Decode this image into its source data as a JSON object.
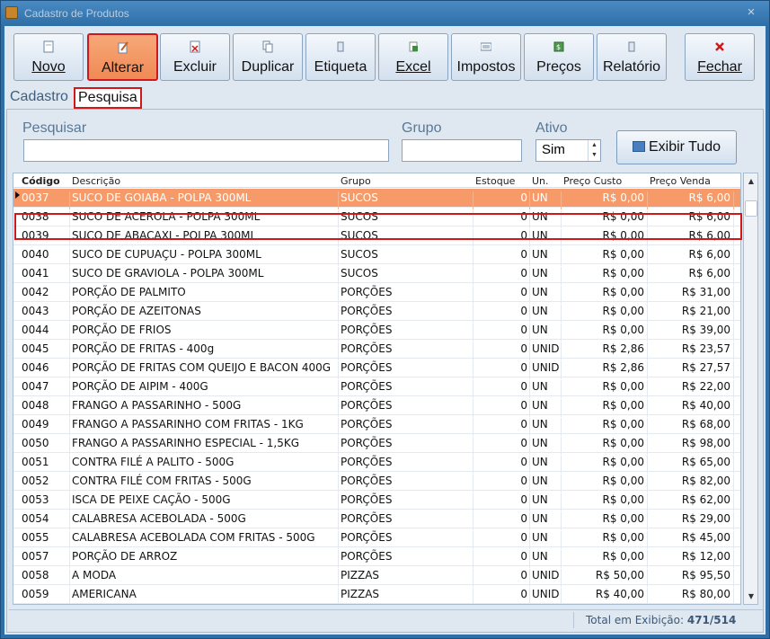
{
  "window": {
    "title": "Cadastro de Produtos",
    "close_label": "×"
  },
  "toolbar": {
    "buttons": [
      {
        "label": "Novo",
        "icon": "new-document-icon"
      },
      {
        "label": "Alterar",
        "icon": "edit-pencil-icon",
        "active": true
      },
      {
        "label": "Excluir",
        "icon": "delete-document-icon"
      },
      {
        "label": "Duplicar",
        "icon": "duplicate-icon"
      },
      {
        "label": "Etiqueta",
        "icon": "label-icon"
      },
      {
        "label": "Excel",
        "icon": "excel-icon"
      },
      {
        "label": "Impostos",
        "icon": "taxes-icon"
      },
      {
        "label": "Preços",
        "icon": "prices-icon"
      },
      {
        "label": "Relatório",
        "icon": "report-icon"
      },
      {
        "label": "Fechar",
        "icon": "close-x-icon"
      }
    ]
  },
  "tabs": [
    {
      "label": "Cadastro",
      "active": false
    },
    {
      "label": "Pesquisa",
      "active": true
    }
  ],
  "filters": {
    "pesquisar_label": "Pesquisar",
    "pesquisar_value": "",
    "grupo_label": "Grupo",
    "grupo_value": "",
    "ativo_label": "Ativo",
    "ativo_value": "Sim",
    "exibir_tudo_label": "Exibir Tudo"
  },
  "grid": {
    "columns": [
      "Código",
      "Descrição",
      "Grupo",
      "Estoque",
      "Un.",
      "Preço Custo",
      "Preço Venda"
    ],
    "rows": [
      [
        "0037",
        "SUCO DE GOIABA - POLPA 300ML",
        "SUCOS",
        "0",
        "UN",
        "R$ 0,00",
        "R$ 6,00"
      ],
      [
        "0038",
        "SUCO DE ACEROLA - POLPA 300ML",
        "SUCOS",
        "0",
        "UN",
        "R$ 0,00",
        "R$ 6,00"
      ],
      [
        "0039",
        "SUCO DE ABACAXI - POLPA 300ML",
        "SUCOS",
        "0",
        "UN",
        "R$ 0,00",
        "R$ 6,00"
      ],
      [
        "0040",
        "SUCO DE CUPUAÇU - POLPA 300ML",
        "SUCOS",
        "0",
        "UN",
        "R$ 0,00",
        "R$ 6,00"
      ],
      [
        "0041",
        "SUCO DE GRAVIOLA - POLPA 300ML",
        "SUCOS",
        "0",
        "UN",
        "R$ 0,00",
        "R$ 6,00"
      ],
      [
        "0042",
        "PORÇÃO DE PALMITO",
        "PORÇÕES",
        "0",
        "UN",
        "R$ 0,00",
        "R$ 31,00"
      ],
      [
        "0043",
        "PORÇÃO DE AZEITONAS",
        "PORÇÕES",
        "0",
        "UN",
        "R$ 0,00",
        "R$ 21,00"
      ],
      [
        "0044",
        "PORÇÃO DE FRIOS",
        "PORÇÕES",
        "0",
        "UN",
        "R$ 0,00",
        "R$ 39,00"
      ],
      [
        "0045",
        "PORÇÃO DE FRITAS - 400g",
        "PORÇÕES",
        "0",
        "UNID",
        "R$ 2,86",
        "R$ 23,57"
      ],
      [
        "0046",
        "PORÇÃO DE FRITAS COM QUEIJO E BACON 400G",
        "PORÇÕES",
        "0",
        "UNID",
        "R$ 2,86",
        "R$ 27,57"
      ],
      [
        "0047",
        "PORÇÃO DE AIPIM - 400G",
        "PORÇÕES",
        "0",
        "UN",
        "R$ 0,00",
        "R$ 22,00"
      ],
      [
        "0048",
        "FRANGO A PASSARINHO - 500G",
        "PORÇÕES",
        "0",
        "UN",
        "R$ 0,00",
        "R$ 40,00"
      ],
      [
        "0049",
        "FRANGO A PASSARINHO COM FRITAS - 1KG",
        "PORÇÕES",
        "0",
        "UN",
        "R$ 0,00",
        "R$ 68,00"
      ],
      [
        "0050",
        "FRANGO A PASSARINHO ESPECIAL - 1,5KG",
        "PORÇÕES",
        "0",
        "UN",
        "R$ 0,00",
        "R$ 98,00"
      ],
      [
        "0051",
        "CONTRA FILÉ A PALITO - 500G",
        "PORÇÕES",
        "0",
        "UN",
        "R$ 0,00",
        "R$ 65,00"
      ],
      [
        "0052",
        "CONTRA FILÉ COM FRITAS - 500G",
        "PORÇÕES",
        "0",
        "UN",
        "R$ 0,00",
        "R$ 82,00"
      ],
      [
        "0053",
        "ISCA DE PEIXE CAÇÃO - 500G",
        "PORÇÕES",
        "0",
        "UN",
        "R$ 0,00",
        "R$ 62,00"
      ],
      [
        "0054",
        "CALABRESA ACEBOLADA - 500G",
        "PORÇÕES",
        "0",
        "UN",
        "R$ 0,00",
        "R$ 29,00"
      ],
      [
        "0055",
        "CALABRESA ACEBOLADA COM FRITAS - 500G",
        "PORÇÕES",
        "0",
        "UN",
        "R$ 0,00",
        "R$ 45,00"
      ],
      [
        "0057",
        "PORÇÃO DE ARROZ",
        "PORÇÕES",
        "0",
        "UN",
        "R$ 0,00",
        "R$ 12,00"
      ],
      [
        "0058",
        "A MODA",
        "PIZZAS",
        "0",
        "UNID",
        "R$ 50,00",
        "R$ 95,50"
      ],
      [
        "0059",
        "AMERICANA",
        "PIZZAS",
        "0",
        "UNID",
        "R$ 40,00",
        "R$ 80,00"
      ]
    ],
    "selected_index": 0
  },
  "status": {
    "label": "Total em Exibição:",
    "value": "471/514"
  },
  "colors": {
    "accent": "#2f6fa8",
    "selected_row": "#f59a68",
    "highlight_border": "#d11818"
  }
}
